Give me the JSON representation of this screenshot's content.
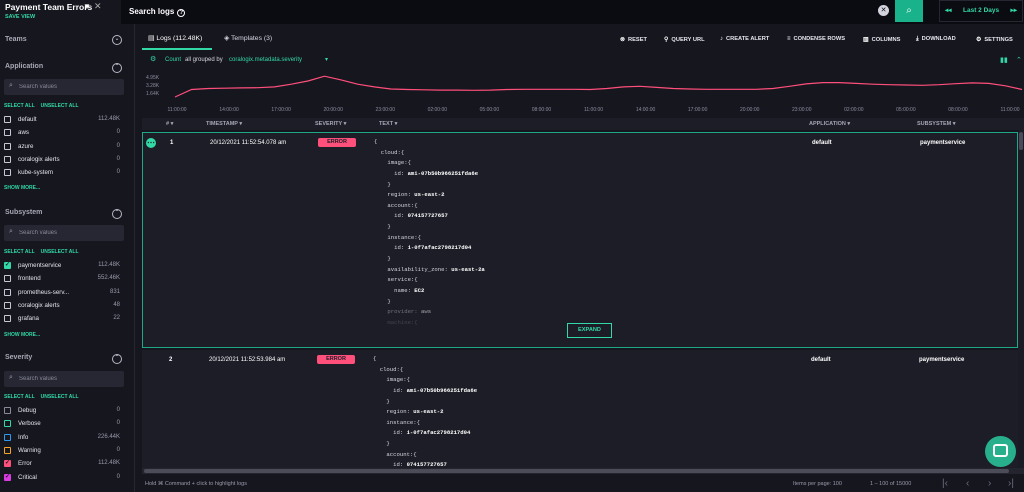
{
  "view": {
    "title": "Payment Team Errors",
    "save": "SAVE VIEW"
  },
  "search": {
    "placeholder": "Search logs",
    "time_range": "Last 2 Days"
  },
  "sidebar": {
    "teams": {
      "label": "Teams"
    },
    "application": {
      "label": "Application",
      "search_placeholder": "Search values",
      "select_all": "SELECT ALL",
      "unselect_all": "UNSELECT ALL",
      "show_more": "SHOW MORE...",
      "items": [
        {
          "name": "default",
          "count": "112.48K",
          "checked": false
        },
        {
          "name": "aws",
          "count": "0",
          "checked": false
        },
        {
          "name": "azure",
          "count": "0",
          "checked": false
        },
        {
          "name": "coralogix alerts",
          "count": "0",
          "checked": false
        },
        {
          "name": "kube-system",
          "count": "0",
          "checked": false
        }
      ]
    },
    "subsystem": {
      "label": "Subsystem",
      "search_placeholder": "Search values",
      "select_all": "SELECT ALL",
      "unselect_all": "UNSELECT ALL",
      "show_more": "SHOW MORE...",
      "items": [
        {
          "name": "paymentservice",
          "count": "112.48K",
          "checked": true
        },
        {
          "name": "frontend",
          "count": "552.46K",
          "checked": false
        },
        {
          "name": "prometheus-serv...",
          "count": "831",
          "checked": false
        },
        {
          "name": "coralogix alerts",
          "count": "48",
          "checked": false
        },
        {
          "name": "grafana",
          "count": "22",
          "checked": false
        }
      ]
    },
    "severity": {
      "label": "Severity",
      "search_placeholder": "Search values",
      "select_all": "SELECT ALL",
      "unselect_all": "UNSELECT ALL",
      "items": [
        {
          "name": "Debug",
          "count": "0",
          "color": "#8a8b99",
          "checked": false
        },
        {
          "name": "Verbose",
          "count": "0",
          "color": "#32d9a6",
          "checked": false
        },
        {
          "name": "Info",
          "count": "226.44K",
          "color": "#2f9bf0",
          "checked": false
        },
        {
          "name": "Warning",
          "count": "0",
          "color": "#f5a623",
          "checked": false
        },
        {
          "name": "Error",
          "count": "112.48K",
          "color": "#ff4f7b",
          "checked": true
        },
        {
          "name": "Critical",
          "count": "0",
          "color": "#d93ce0",
          "checked": true
        }
      ]
    }
  },
  "tabs": [
    {
      "label": "Logs (112.48K)"
    },
    {
      "label": "Templates (3)"
    }
  ],
  "actions": {
    "reset": "RESET",
    "query_url": "QUERY URL",
    "create_alert": "CREATE ALERT",
    "condense_rows": "CONDENSE ROWS",
    "columns": "COLUMNS",
    "download": "DOWNLOAD",
    "settings": "SETTINGS"
  },
  "count_bar": {
    "count": "Count",
    "all_grouped_by": "all grouped by",
    "field": "coralogix.metadata.severity"
  },
  "chart_data": {
    "type": "line",
    "y_ticks": [
      "4.95K",
      "3.28K",
      "1.64K"
    ],
    "x_ticks": [
      "11:00:00",
      "14:00:00",
      "17:00:00",
      "20:00:00",
      "23:00:00",
      "02:00:00",
      "05:00:00",
      "08:00:00",
      "11:00:00",
      "14:00:00",
      "17:00:00",
      "20:00:00",
      "23:00:00",
      "02:00:00",
      "05:00:00",
      "08:00:00",
      "11:00:00"
    ],
    "series": [
      {
        "color": "#ff4f7b",
        "values": [
          1500,
          2900,
          3100,
          3150,
          3200,
          3250,
          3400,
          3900,
          4500,
          5400,
          4700,
          3900,
          3400,
          3000,
          2900,
          2850,
          2800,
          2800,
          2750,
          2800,
          2900,
          2950,
          2950,
          2950,
          2950,
          2900,
          3100,
          3400,
          3500,
          3300,
          3100,
          3000,
          2950,
          2950,
          2950,
          2950,
          3100,
          3500,
          3950,
          4200,
          4200,
          4050,
          3900,
          3800,
          3750,
          3700,
          3800,
          4000,
          4150,
          4050,
          3600,
          2900
        ]
      }
    ],
    "ylim": [
      0,
      6000
    ]
  },
  "table": {
    "headers": {
      "num": "#",
      "timestamp": "TIMESTAMP",
      "severity": "SEVERITY",
      "text": "TEXT",
      "application": "APPLICATION",
      "subsystem": "SUBSYSTEM"
    },
    "rows": [
      {
        "num": "1",
        "timestamp": "20/12/2021 11:52:54.078 am",
        "severity": "ERROR",
        "application": "default",
        "subsystem": "paymentservice",
        "text": [
          {
            "k": "{",
            "v": ""
          },
          {
            "k": "  cloud:{",
            "v": ""
          },
          {
            "k": "    image:{",
            "v": ""
          },
          {
            "k": "      id: ",
            "v": "ami-07b50b966251fda6e"
          },
          {
            "k": "    }",
            "v": ""
          },
          {
            "k": "    region: ",
            "v": "us-east-2"
          },
          {
            "k": "    account:{",
            "v": ""
          },
          {
            "k": "      id: ",
            "v": "074157727657"
          },
          {
            "k": "    }",
            "v": ""
          },
          {
            "k": "    instance:{",
            "v": ""
          },
          {
            "k": "      id: ",
            "v": "i-0f7afac2798217d04"
          },
          {
            "k": "    }",
            "v": ""
          },
          {
            "k": "    availability_zone: ",
            "v": "us-east-2a"
          },
          {
            "k": "    service:{",
            "v": ""
          },
          {
            "k": "      name: ",
            "v": "EC2"
          },
          {
            "k": "    }",
            "v": ""
          },
          {
            "k": "    provider: ",
            "v": "aws"
          },
          {
            "k": "    machine:{",
            "v": ""
          }
        ]
      },
      {
        "num": "2",
        "timestamp": "20/12/2021 11:52:53.984 am",
        "severity": "ERROR",
        "application": "default",
        "subsystem": "paymentservice",
        "text": [
          {
            "k": "{",
            "v": ""
          },
          {
            "k": "  cloud:{",
            "v": ""
          },
          {
            "k": "    image:{",
            "v": ""
          },
          {
            "k": "      id: ",
            "v": "ami-07b50b966251fda6e"
          },
          {
            "k": "    }",
            "v": ""
          },
          {
            "k": "    region: ",
            "v": "us-east-2"
          },
          {
            "k": "    instance:{",
            "v": ""
          },
          {
            "k": "      id: ",
            "v": "i-0f7afac2798217d04"
          },
          {
            "k": "    }",
            "v": ""
          },
          {
            "k": "    account:{",
            "v": ""
          },
          {
            "k": "      id: ",
            "v": "074157727657"
          }
        ]
      }
    ],
    "expand_label": "EXPAND"
  },
  "footer": {
    "hint": "Hold ⌘ Command + click to highlight logs",
    "per_page": "Items per page: 100",
    "range": "1 – 100 of 15000"
  }
}
